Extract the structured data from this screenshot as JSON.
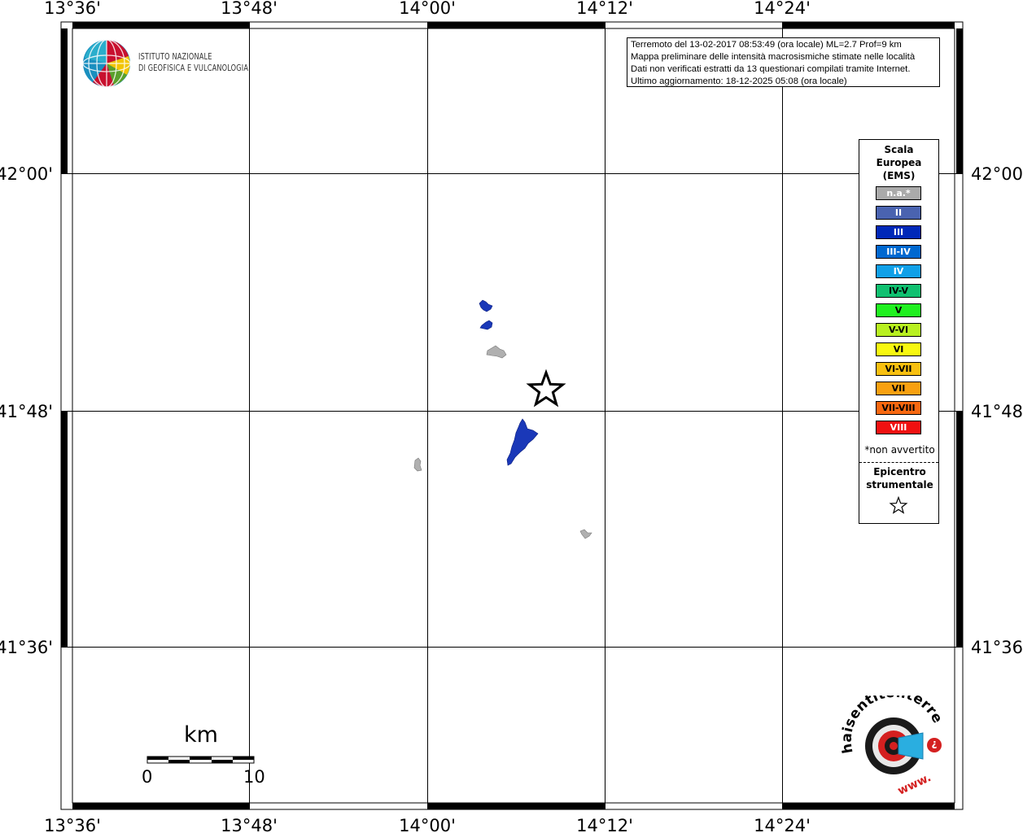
{
  "map": {
    "lon_labels": [
      "13°36'",
      "13°48'",
      "14°00'",
      "14°12'",
      "14°24'"
    ],
    "lat_labels": [
      "42°00'",
      "41°48'",
      "41°36'"
    ],
    "epicenter_symbol": "star"
  },
  "logo_ingv": {
    "line1": "ISTITUTO NAZIONALE",
    "line2": "DI GEOFISICA E VULCANOLOGIA"
  },
  "info": {
    "line1": "Terremoto del 13-02-2017 08:53:49 (ora locale) ML=2.7 Prof=9 km",
    "line2": "Mappa preliminare delle intensità macrosismiche stimate nelle località",
    "line3": "Dati non verificati estratti da 13 questionari compilati tramite Internet.",
    "line4": "Ultimo aggiornamento: 18-12-2025 05:08 (ora locale)"
  },
  "legend": {
    "title1": "Scala",
    "title2": "Europea",
    "title3": "(EMS)",
    "items": [
      {
        "label": "n.a.*",
        "color": "#aaaaaa",
        "text_color": "#ffffff"
      },
      {
        "label": "II",
        "color": "#4a63b0",
        "text_color": "#ffffff"
      },
      {
        "label": "III",
        "color": "#0028b8",
        "text_color": "#ffffff"
      },
      {
        "label": "III-IV",
        "color": "#0068d0",
        "text_color": "#ffffff"
      },
      {
        "label": "IV",
        "color": "#10a0e8",
        "text_color": "#ffffff"
      },
      {
        "label": "IV-V",
        "color": "#10c070",
        "text_color": "#000000"
      },
      {
        "label": "V",
        "color": "#20f020",
        "text_color": "#000000"
      },
      {
        "label": "V-VI",
        "color": "#b8f020",
        "text_color": "#000000"
      },
      {
        "label": "VI",
        "color": "#f8f810",
        "text_color": "#000000"
      },
      {
        "label": "VI-VII",
        "color": "#f8c010",
        "text_color": "#000000"
      },
      {
        "label": "VII",
        "color": "#f8a010",
        "text_color": "#000000"
      },
      {
        "label": "VII-VIII",
        "color": "#f86810",
        "text_color": "#000000"
      },
      {
        "label": "VIII",
        "color": "#f01010",
        "text_color": "#ffffff"
      }
    ],
    "note": "*non avvertito",
    "epi1": "Epicentro",
    "epi2": "strumentale"
  },
  "scalebar": {
    "unit": "km",
    "min": "0",
    "max": "10"
  },
  "logo_hst": {
    "text": "haisentitoilterremoto.it",
    "www": "www."
  }
}
